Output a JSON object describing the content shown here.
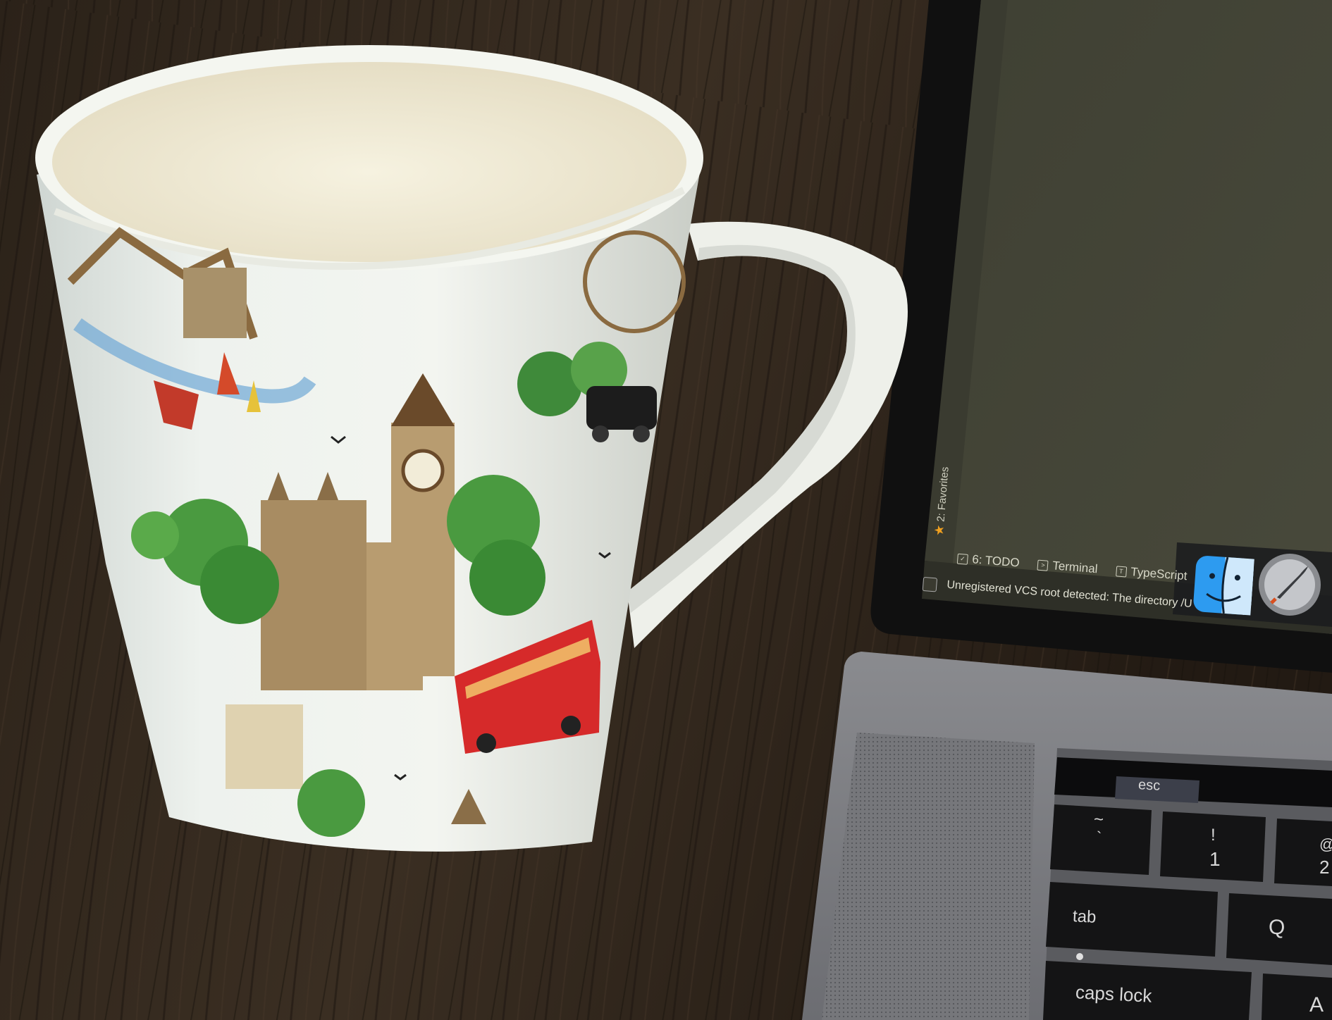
{
  "ide": {
    "favorites_label": "2: Favorites",
    "tabs": [
      {
        "label": "6: TODO"
      },
      {
        "label": "Terminal"
      },
      {
        "label": "TypeScript"
      }
    ],
    "status_message": "Unregistered VCS root detected: The directory /U"
  },
  "keyboard": {
    "esc": "esc",
    "tilde_top": "~",
    "tilde_bottom": "`",
    "one_top": "!",
    "one_bottom": "1",
    "two_top": "@",
    "two_bottom": "2",
    "tab": "tab",
    "q": "Q",
    "caps_lock": "caps lock",
    "a": "A"
  },
  "icons": [
    "finder-icon",
    "launchpad-icon",
    "star-icon"
  ]
}
